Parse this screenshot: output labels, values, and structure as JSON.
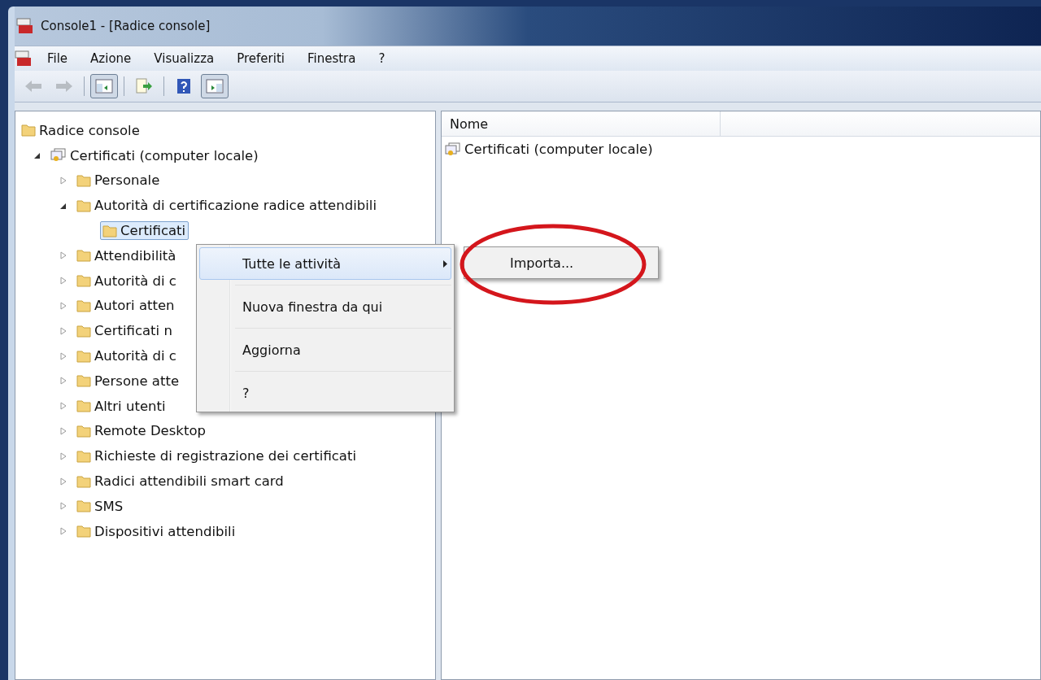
{
  "window": {
    "title": "Console1 - [Radice console]"
  },
  "menu": [
    "File",
    "Azione",
    "Visualizza",
    "Preferiti",
    "Finestra",
    "?"
  ],
  "toolbar_groups": [
    [
      {
        "kind": "back",
        "disabled": true
      },
      {
        "kind": "forward",
        "disabled": true
      }
    ],
    [
      {
        "kind": "tree-pane",
        "pressed": true
      }
    ],
    [
      {
        "kind": "export",
        "pressed": false
      }
    ],
    [
      {
        "kind": "help",
        "pressed": false
      },
      {
        "kind": "action-pane",
        "pressed": true
      }
    ]
  ],
  "tree": [
    {
      "label": "Radice console",
      "kind": "folder",
      "selected": false,
      "children": [
        {
          "label": "Certificati (computer locale)",
          "kind": "certificate",
          "expanded": true,
          "selected": false,
          "children": [
            {
              "label": "Personale",
              "kind": "folder",
              "expanded": false,
              "selected": false
            },
            {
              "label": "Autorità di certificazione radice attendibili",
              "kind": "folder",
              "expanded": true,
              "selected": false,
              "children": [
                {
                  "label": "Certificati",
                  "kind": "folder",
                  "selected": true
                }
              ]
            },
            {
              "label": "Attendibilità",
              "kind": "folder",
              "expanded": false,
              "selected": false
            },
            {
              "label": "Autorità di c",
              "kind": "folder",
              "expanded": false,
              "selected": false
            },
            {
              "label": "Autori atten",
              "kind": "folder",
              "expanded": false,
              "selected": false
            },
            {
              "label": "Certificati n",
              "kind": "folder",
              "expanded": false,
              "selected": false
            },
            {
              "label": "Autorità di c",
              "kind": "folder",
              "expanded": false,
              "selected": false
            },
            {
              "label": "Persone atte",
              "kind": "folder",
              "expanded": false,
              "selected": false
            },
            {
              "label": "Altri utenti",
              "kind": "folder",
              "expanded": false,
              "selected": false
            },
            {
              "label": "Remote Desktop",
              "kind": "folder",
              "expanded": false,
              "selected": false
            },
            {
              "label": "Richieste di registrazione dei certificati",
              "kind": "folder",
              "expanded": false,
              "selected": false
            },
            {
              "label": "Radici attendibili smart card",
              "kind": "folder",
              "expanded": false,
              "selected": false
            },
            {
              "label": "SMS",
              "kind": "folder",
              "expanded": false,
              "selected": false
            },
            {
              "label": "Dispositivi attendibili",
              "kind": "folder",
              "expanded": false,
              "selected": false
            }
          ]
        }
      ]
    }
  ],
  "list": {
    "columns": [
      "Nome"
    ],
    "rows": [
      {
        "label": "Certificati (computer locale)",
        "kind": "certificate"
      }
    ]
  },
  "context_menu": {
    "items": [
      {
        "label": "Tutte le attività",
        "kind": "submenu",
        "selected": true
      },
      {
        "label": "Nuova finestra da qui",
        "kind": "item",
        "selected": false
      },
      {
        "label": "Aggiorna",
        "kind": "item",
        "selected": false
      },
      {
        "label": "?",
        "kind": "item",
        "selected": false
      }
    ],
    "submenu": {
      "items": [
        {
          "label": "Importa...",
          "selected": false
        }
      ]
    }
  },
  "annotation": {
    "kind": "ellipse",
    "color": "#d4161c"
  }
}
